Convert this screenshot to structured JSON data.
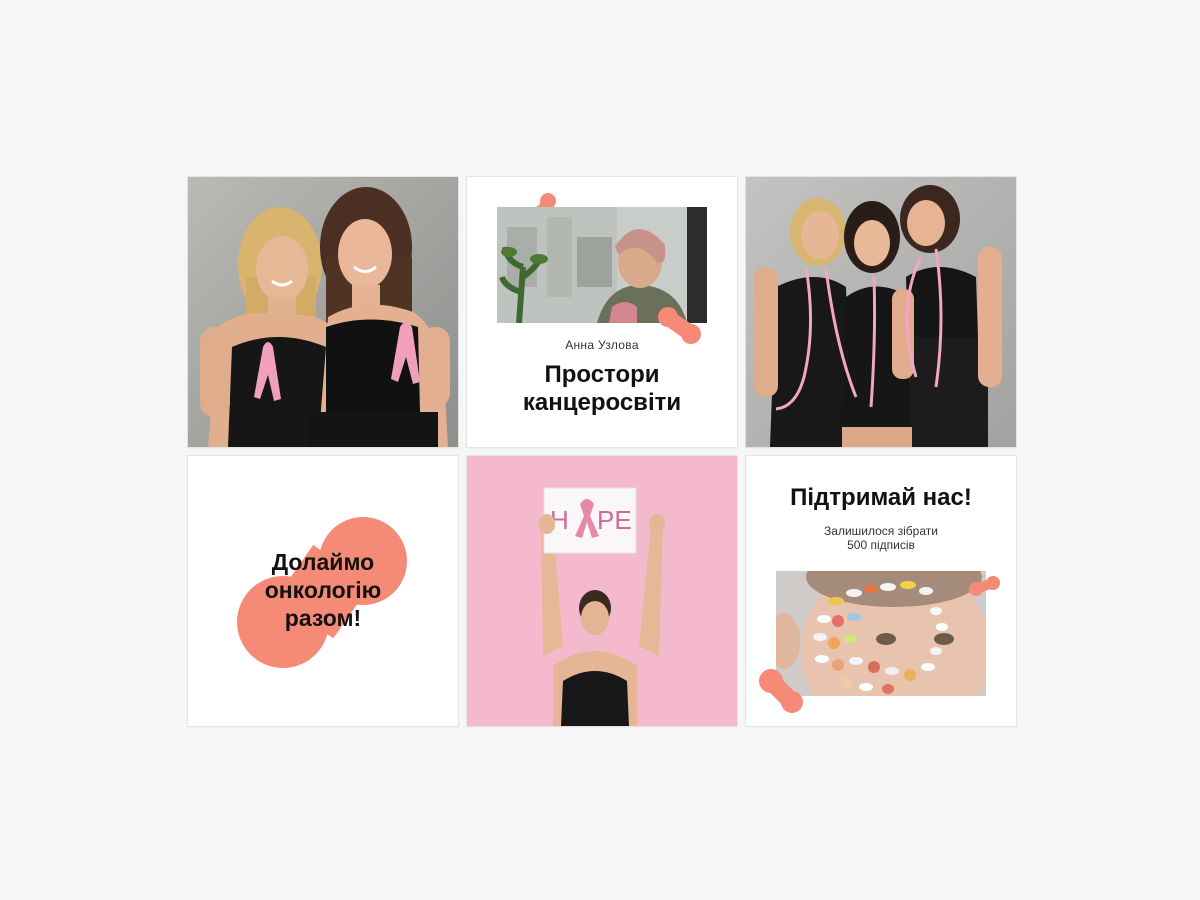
{
  "accent_color": "#f58a77",
  "tiles": [
    {
      "name": "two-women-ribbons-photo",
      "kind": "photo",
      "icon": "pink-ribbon-icon"
    },
    {
      "name": "prostory-post",
      "kind": "text-photo",
      "author": "Анна Узлова",
      "title_line1": "Простори",
      "title_line2": "канцеросвіти"
    },
    {
      "name": "three-women-tape-photo",
      "kind": "photo"
    },
    {
      "name": "dolaimo-post",
      "kind": "text",
      "title_line1": "Долаймо",
      "title_line2": "онкологію",
      "title_line3": "разом!"
    },
    {
      "name": "hope-sign-photo",
      "kind": "photo",
      "sign_text_1": "H",
      "sign_text_2": "PE"
    },
    {
      "name": "support-post",
      "kind": "text-photo",
      "title": "Підтримай нас!",
      "subtitle_line1": "Залишилося зібрати",
      "subtitle_line2": "500 підписів"
    }
  ]
}
